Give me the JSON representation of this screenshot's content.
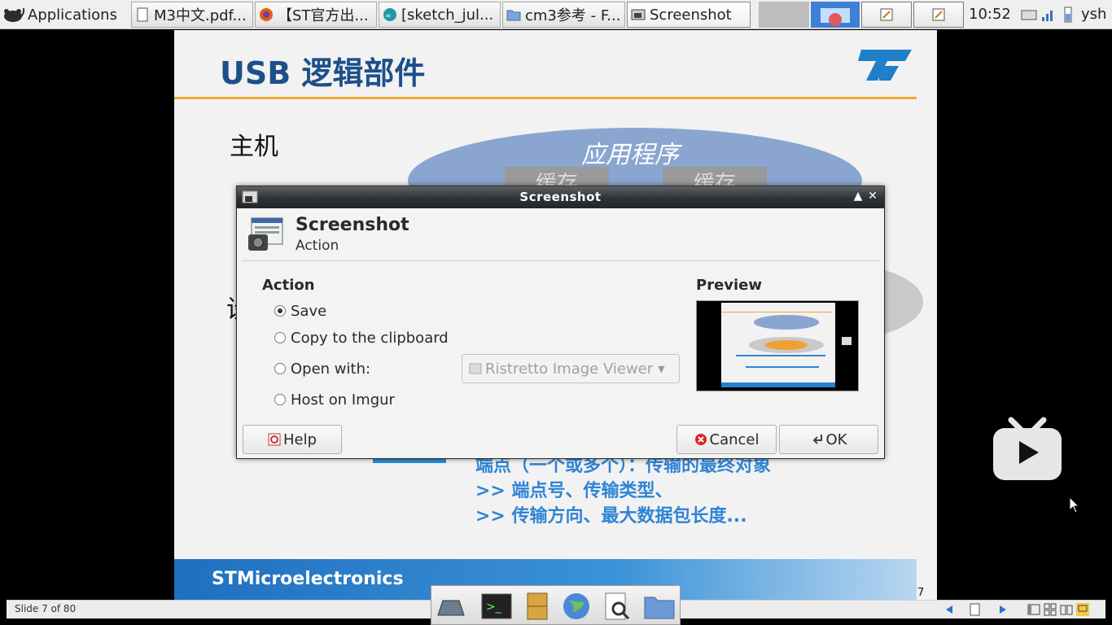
{
  "panel": {
    "apps_label": "Applications",
    "tasks": [
      {
        "label": "M3中文.pdf..."
      },
      {
        "label": "【ST官方出..."
      },
      {
        "label": "[sketch_jul..."
      },
      {
        "label": "cm3参考 - F..."
      },
      {
        "label": "Screenshot"
      }
    ],
    "clock": "10:52",
    "user": "ysh"
  },
  "slide": {
    "title": "USB 逻辑部件",
    "host_label": "主机",
    "app_label": "应用程序",
    "buffer_label": "缓存",
    "side_char": "设",
    "endpoint_lines": [
      "端点（一个或多个）：传输的最终对象",
      ">> 端点号、传输类型、",
      ">> 传输方向、最大数据包长度..."
    ],
    "footer": "STMicroelectronics",
    "page_number": "7"
  },
  "status": {
    "slide_info": "Slide 7 of 80"
  },
  "dialog": {
    "window_title": "Screenshot",
    "header_title": "Screenshot",
    "header_subtitle": "Action",
    "action_label": "Action",
    "options": {
      "save": "Save",
      "clipboard": "Copy to the clipboard",
      "open_with": "Open with:",
      "imgur": "Host on Imgur"
    },
    "selected": "save",
    "open_with_app": "Ristretto Image Viewer",
    "preview_label": "Preview",
    "buttons": {
      "help": "Help",
      "cancel": "Cancel",
      "ok": "OK"
    }
  }
}
